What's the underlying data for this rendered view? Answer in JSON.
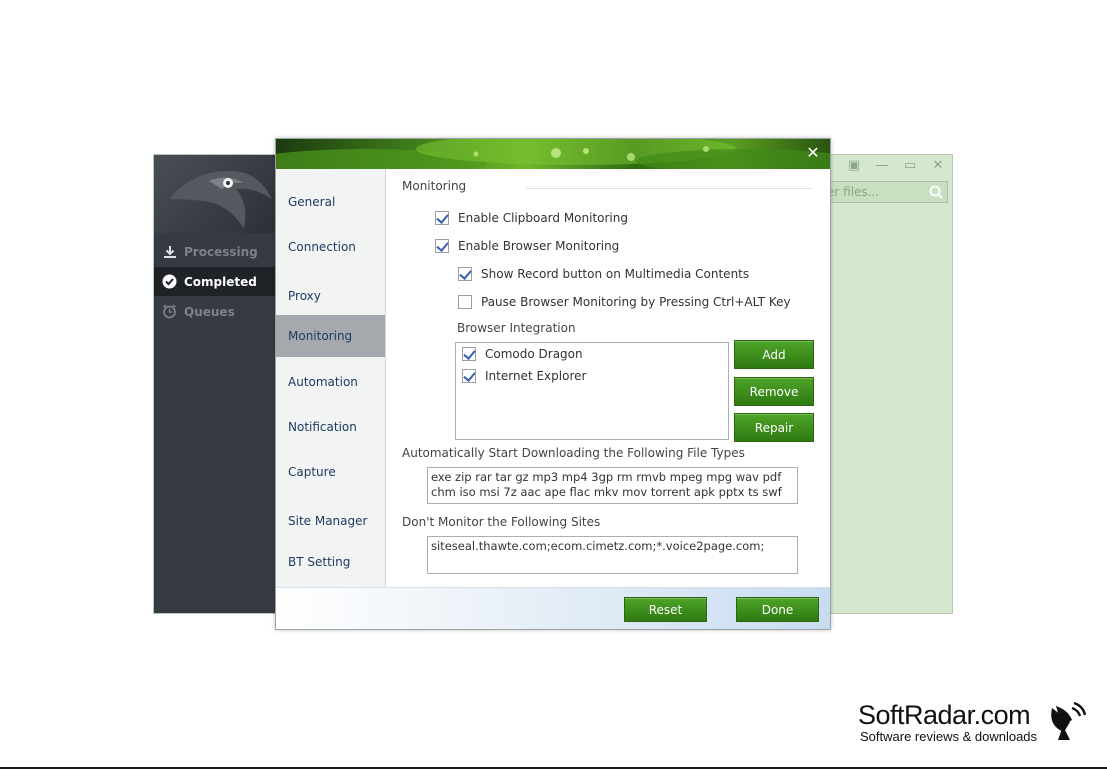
{
  "app": {
    "nav": [
      {
        "label": "Processing",
        "icon": "download-icon"
      },
      {
        "label": "Completed",
        "icon": "check-circle-icon"
      },
      {
        "label": "Queues",
        "icon": "alarm-clock-icon"
      }
    ],
    "search_placeholder": "er files..."
  },
  "dialog": {
    "close_label": "✕",
    "nav": [
      "General",
      "Connection",
      "Proxy",
      "Monitoring",
      "Automation",
      "Notification",
      "Capture",
      "Site Manager",
      "BT Setting"
    ],
    "active_nav": "Monitoring",
    "section_title": "Monitoring",
    "checks": {
      "clipboard": {
        "label": "Enable Clipboard Monitoring",
        "checked": true
      },
      "browser": {
        "label": "Enable Browser Monitoring",
        "checked": true
      },
      "record_button": {
        "label": "Show Record button on Multimedia Contents",
        "checked": true
      },
      "pause": {
        "label": "Pause Browser Monitoring by Pressing Ctrl+ALT Key",
        "checked": false
      }
    },
    "browser_integration": {
      "label": "Browser Integration",
      "items": [
        {
          "label": "Comodo Dragon",
          "checked": true
        },
        {
          "label": "Internet Explorer",
          "checked": true
        }
      ],
      "add": "Add",
      "remove": "Remove",
      "repair": "Repair"
    },
    "auto_types": {
      "label": "Automatically Start Downloading the Following File Types",
      "value": "exe zip rar tar gz mp3 mp4 3gp rm rmvb mpeg mpg wav pdf chm iso msi 7z aac ape flac mkv mov torrent apk pptx ts swf"
    },
    "exclude_sites": {
      "label": "Don't Monitor the Following Sites",
      "value": "siteseal.thawte.com;ecom.cimetz.com;*.voice2page.com;"
    },
    "reset": "Reset",
    "done": "Done"
  },
  "watermark": {
    "title": "SoftRadar.com",
    "subtitle": "Software reviews & downloads"
  },
  "colors": {
    "sidebar_dark": "#363a42",
    "accent_green": "#3b8f1b",
    "nav_active": "#a5a9ad"
  }
}
